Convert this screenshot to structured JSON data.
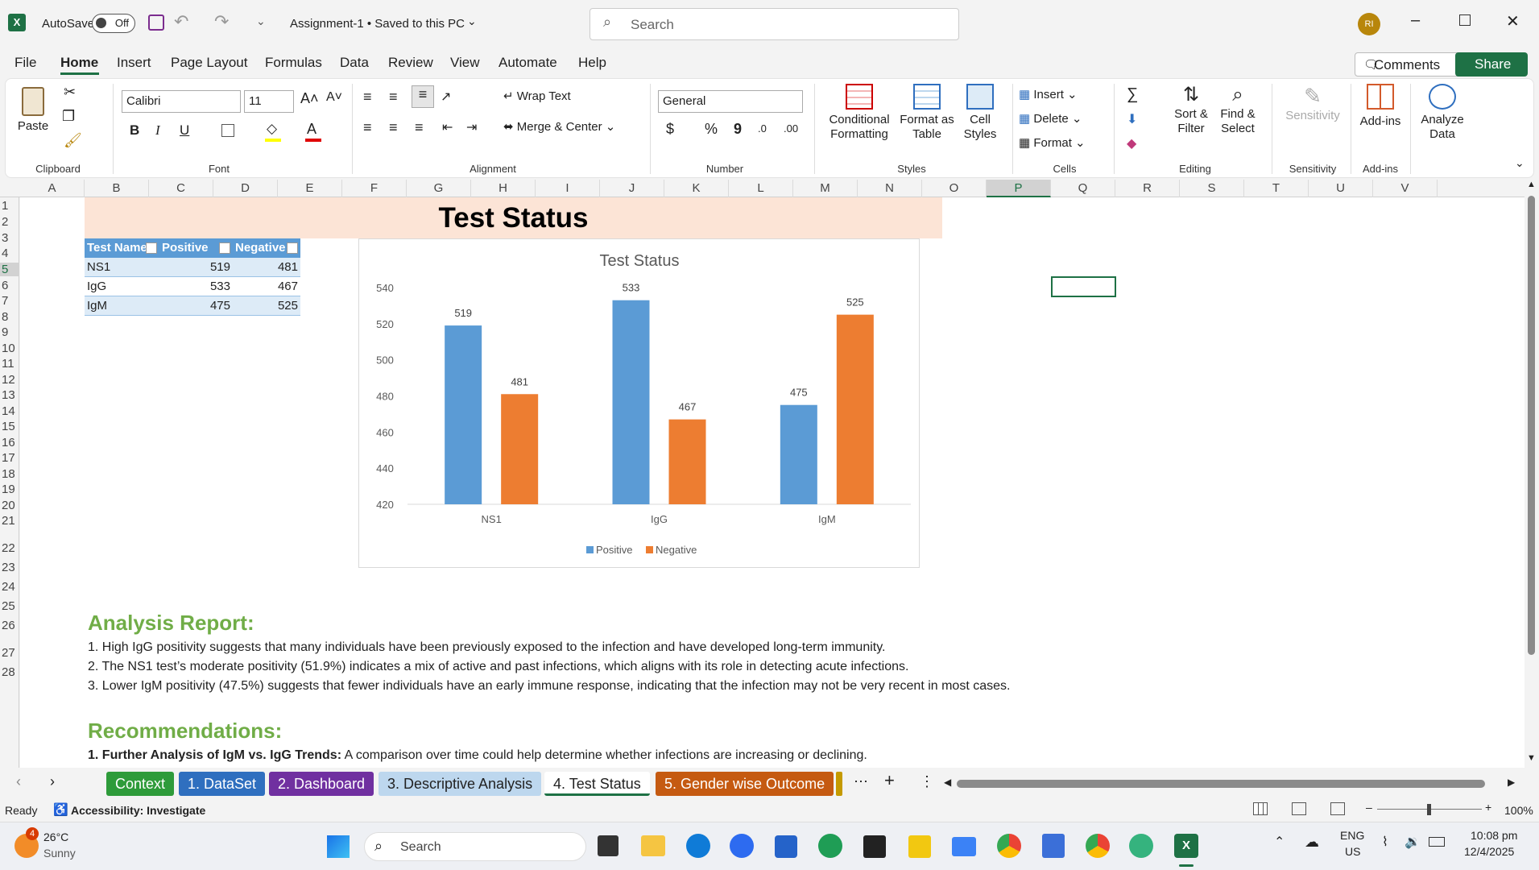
{
  "titlebar": {
    "autosave_label": "AutoSave",
    "autosave_state": "Off",
    "doc_title": "Assignment-1 • Saved to this PC",
    "search_placeholder": "Search",
    "avatar_initials": "RI"
  },
  "menu": {
    "items": [
      "File",
      "Home",
      "Insert",
      "Page Layout",
      "Formulas",
      "Data",
      "Review",
      "View",
      "Automate",
      "Help"
    ],
    "active": "Home",
    "comments": "Comments",
    "share": "Share"
  },
  "ribbon": {
    "clipboard": {
      "paste": "Paste",
      "label": "Clipboard"
    },
    "font": {
      "name": "Calibri",
      "size": "11",
      "label": "Font"
    },
    "alignment": {
      "wrap": "Wrap Text",
      "merge": "Merge & Center",
      "label": "Alignment"
    },
    "number": {
      "format": "General",
      "label": "Number"
    },
    "styles": {
      "cond1": "Conditional",
      "cond2": "Formatting",
      "fmt1": "Format as",
      "fmt2": "Table",
      "cell1": "Cell",
      "cell2": "Styles",
      "label": "Styles"
    },
    "cells": {
      "insert": "Insert",
      "delete": "Delete",
      "format": "Format",
      "label": "Cells"
    },
    "editing": {
      "sort1": "Sort &",
      "sort2": "Filter",
      "find1": "Find &",
      "find2": "Select",
      "label": "Editing"
    },
    "sensitivity": {
      "btn": "Sensitivity",
      "label": "Sensitivity"
    },
    "addins": {
      "btn": "Add-ins",
      "label": "Add-ins"
    },
    "analyze": {
      "l1": "Analyze",
      "l2": "Data"
    }
  },
  "columns": [
    "A",
    "B",
    "C",
    "D",
    "E",
    "F",
    "G",
    "H",
    "I",
    "J",
    "K",
    "L",
    "M",
    "N",
    "O",
    "P",
    "Q",
    "R",
    "S",
    "T",
    "U",
    "V"
  ],
  "rows": [
    "1",
    "2",
    "3",
    "4",
    "5",
    "6",
    "7",
    "8",
    "9",
    "10",
    "11",
    "12",
    "13",
    "14",
    "15",
    "16",
    "17",
    "18",
    "19",
    "20",
    "21",
    "22",
    "23",
    "24",
    "25",
    "26",
    "27",
    "28"
  ],
  "sheet_title": "Test Status",
  "table": {
    "headers": [
      "Test Name",
      "Positive",
      "Negative"
    ],
    "rows": [
      [
        "NS1",
        "519",
        "481"
      ],
      [
        "IgG",
        "533",
        "467"
      ],
      [
        "IgM",
        "475",
        "525"
      ]
    ]
  },
  "chart_data": {
    "type": "bar",
    "title": "Test Status",
    "categories": [
      "NS1",
      "IgG",
      "IgM"
    ],
    "series": [
      {
        "name": "Positive",
        "values": [
          519,
          533,
          475
        ],
        "color": "#5b9bd5"
      },
      {
        "name": "Negative",
        "values": [
          481,
          467,
          525
        ],
        "color": "#ed7d31"
      }
    ],
    "ylim": [
      420,
      540
    ],
    "yticks": [
      "540",
      "520",
      "500",
      "480",
      "460",
      "440",
      "420"
    ],
    "legend": "bottom",
    "grid": false
  },
  "report": {
    "heading": "Analysis Report:",
    "lines": [
      "1. High IgG positivity suggests that many individuals have been previously exposed to the infection and have developed long-term immunity.",
      "2. The NS1 test’s moderate positivity (51.9%) indicates a mix of active and past infections, which aligns with its role in detecting acute infections.",
      "3. Lower IgM positivity (47.5%) suggests that fewer individuals have an early immune response, indicating that the infection may not be very recent in most cases."
    ],
    "rec_heading": "Recommendations:",
    "rec_bold": "1. Further Analysis of IgM vs. IgG Trends:",
    "rec_text": " A comparison over time could help determine whether infections are increasing or declining."
  },
  "tabs": [
    {
      "label": "Context",
      "color": "#2e9b3a"
    },
    {
      "label": "1. DataSet",
      "color": "#2f6fbf"
    },
    {
      "label": "2. Dashboard",
      "color": "#7030a0"
    },
    {
      "label": "3. Descriptive Analysis",
      "color": "#bdd7ee"
    },
    {
      "label": "4. Test Status",
      "color": "#ffffff"
    },
    {
      "label": "5. Gender wise Outcome",
      "color": "#c55a11"
    }
  ],
  "status": {
    "ready": "Ready",
    "accessibility": "Accessibility: Investigate",
    "zoom": "100%"
  },
  "taskbar": {
    "temp": "26°C",
    "weather": "Sunny",
    "badge": "4",
    "search": "Search",
    "lang1": "ENG",
    "lang2": "US",
    "time": "10:08 pm",
    "date": "12/4/2025"
  }
}
